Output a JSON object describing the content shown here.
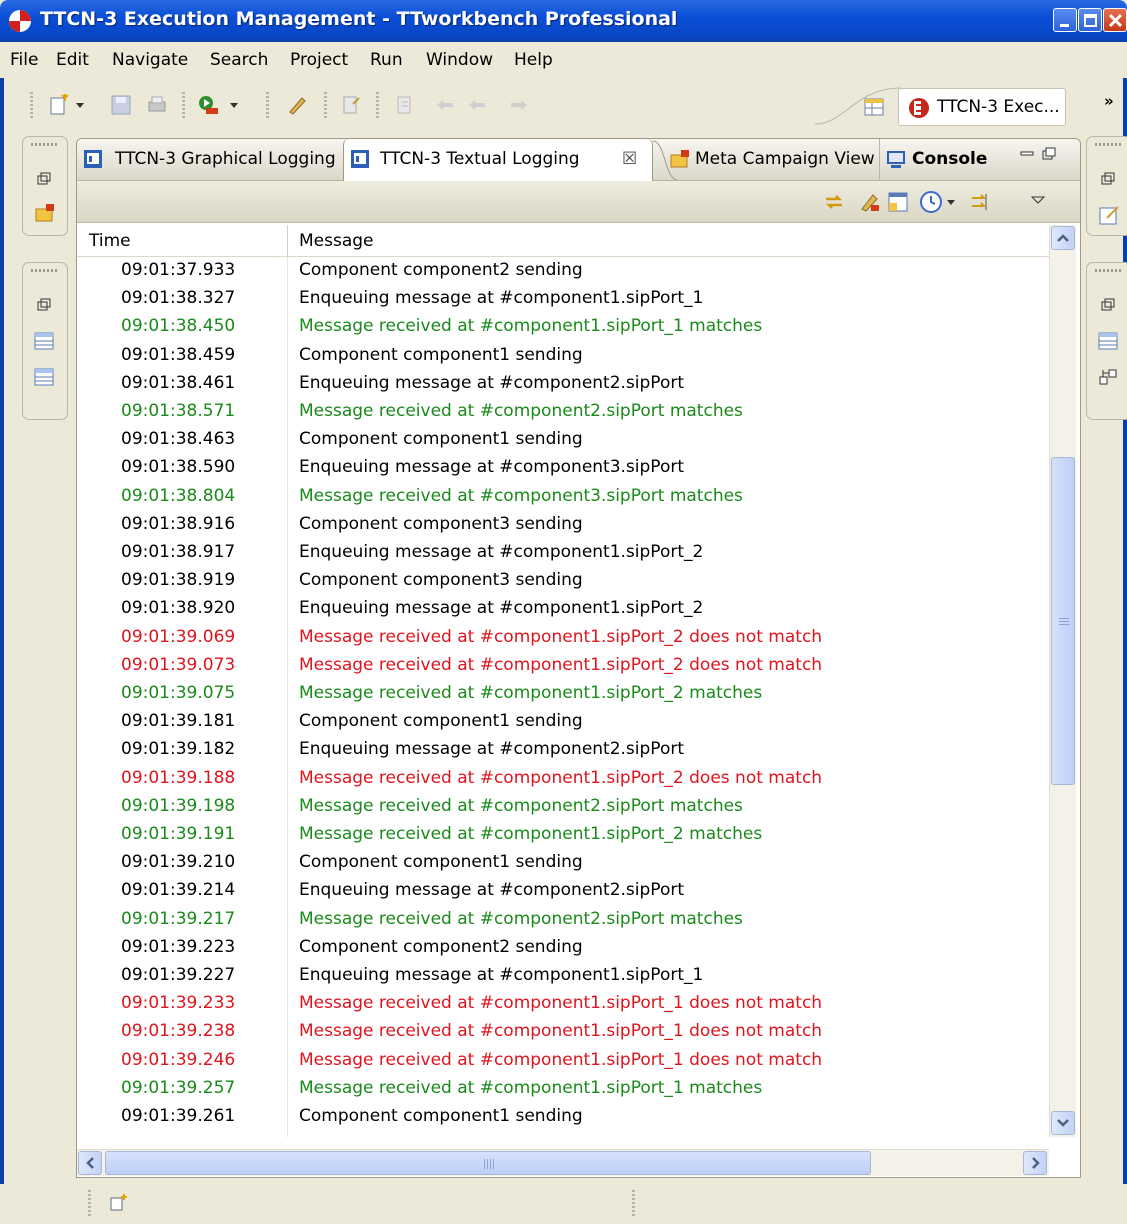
{
  "window": {
    "title": "TTCN-3 Execution Management - TTworkbench Professional"
  },
  "menu": [
    {
      "label": "File"
    },
    {
      "label": "Edit"
    },
    {
      "label": "Navigate"
    },
    {
      "label": "Search"
    },
    {
      "label": "Project"
    },
    {
      "label": "Run"
    },
    {
      "label": "Window"
    },
    {
      "label": "Help"
    }
  ],
  "perspective": {
    "label": "TTCN-3 Exec...",
    "more": "»"
  },
  "tabs": [
    {
      "label": "TTCN-3 Graphical Logging",
      "icon": "logging-view-icon"
    },
    {
      "label": "TTCN-3 Textual Logging",
      "icon": "logging-view-icon",
      "close": "☒"
    },
    {
      "label": "Meta Campaign View",
      "icon": "campaign-folder-icon"
    },
    {
      "label": "Console",
      "icon": "console-icon"
    }
  ],
  "table": {
    "columns": [
      "Time",
      "Message"
    ],
    "colors": {
      "normal": "#000000",
      "match": "#1a8a1a",
      "nomatch": "#e0141e"
    },
    "rows": [
      {
        "time": "09:01:37.933",
        "message": "Component component2 sending",
        "status": "normal"
      },
      {
        "time": "09:01:38.327",
        "message": "Enqueuing message at #component1.sipPort_1",
        "status": "normal"
      },
      {
        "time": "09:01:38.450",
        "message": "Message received at #component1.sipPort_1 matches",
        "status": "match"
      },
      {
        "time": "09:01:38.459",
        "message": "Component component1 sending",
        "status": "normal"
      },
      {
        "time": "09:01:38.461",
        "message": "Enqueuing message at #component2.sipPort",
        "status": "normal"
      },
      {
        "time": "09:01:38.571",
        "message": "Message received at #component2.sipPort matches",
        "status": "match"
      },
      {
        "time": "09:01:38.463",
        "message": "Component component1 sending",
        "status": "normal"
      },
      {
        "time": "09:01:38.590",
        "message": "Enqueuing message at #component3.sipPort",
        "status": "normal"
      },
      {
        "time": "09:01:38.804",
        "message": "Message received at #component3.sipPort matches",
        "status": "match"
      },
      {
        "time": "09:01:38.916",
        "message": "Component component3 sending",
        "status": "normal"
      },
      {
        "time": "09:01:38.917",
        "message": "Enqueuing message at #component1.sipPort_2",
        "status": "normal"
      },
      {
        "time": "09:01:38.919",
        "message": "Component component3 sending",
        "status": "normal"
      },
      {
        "time": "09:01:38.920",
        "message": "Enqueuing message at #component1.sipPort_2",
        "status": "normal"
      },
      {
        "time": "09:01:39.069",
        "message": "Message received at #component1.sipPort_2 does not match",
        "status": "nomatch"
      },
      {
        "time": "09:01:39.073",
        "message": "Message received at #component1.sipPort_2 does not match",
        "status": "nomatch"
      },
      {
        "time": "09:01:39.075",
        "message": "Message received at #component1.sipPort_2 matches",
        "status": "match"
      },
      {
        "time": "09:01:39.181",
        "message": "Component component1 sending",
        "status": "normal"
      },
      {
        "time": "09:01:39.182",
        "message": "Enqueuing message at #component2.sipPort",
        "status": "normal"
      },
      {
        "time": "09:01:39.188",
        "message": "Message received at #component1.sipPort_2 does not match",
        "status": "nomatch"
      },
      {
        "time": "09:01:39.198",
        "message": "Message received at #component2.sipPort matches",
        "status": "match"
      },
      {
        "time": "09:01:39.191",
        "message": "Message received at #component1.sipPort_2 matches",
        "status": "match"
      },
      {
        "time": "09:01:39.210",
        "message": "Component component1 sending",
        "status": "normal"
      },
      {
        "time": "09:01:39.214",
        "message": "Enqueuing message at #component2.sipPort",
        "status": "normal"
      },
      {
        "time": "09:01:39.217",
        "message": "Message received at #component2.sipPort matches",
        "status": "match"
      },
      {
        "time": "09:01:39.223",
        "message": "Component component2 sending",
        "status": "normal"
      },
      {
        "time": "09:01:39.227",
        "message": "Enqueuing message at #component1.sipPort_1",
        "status": "normal"
      },
      {
        "time": "09:01:39.233",
        "message": "Message received at #component1.sipPort_1 does not match",
        "status": "nomatch"
      },
      {
        "time": "09:01:39.238",
        "message": "Message received at #component1.sipPort_1 does not match",
        "status": "nomatch"
      },
      {
        "time": "09:01:39.246",
        "message": "Message received at #component1.sipPort_1 does not match",
        "status": "nomatch"
      },
      {
        "time": "09:01:39.257",
        "message": "Message received at #component1.sipPort_1 matches",
        "status": "match"
      },
      {
        "time": "09:01:39.261",
        "message": "Component component1 sending",
        "status": "normal"
      }
    ]
  }
}
